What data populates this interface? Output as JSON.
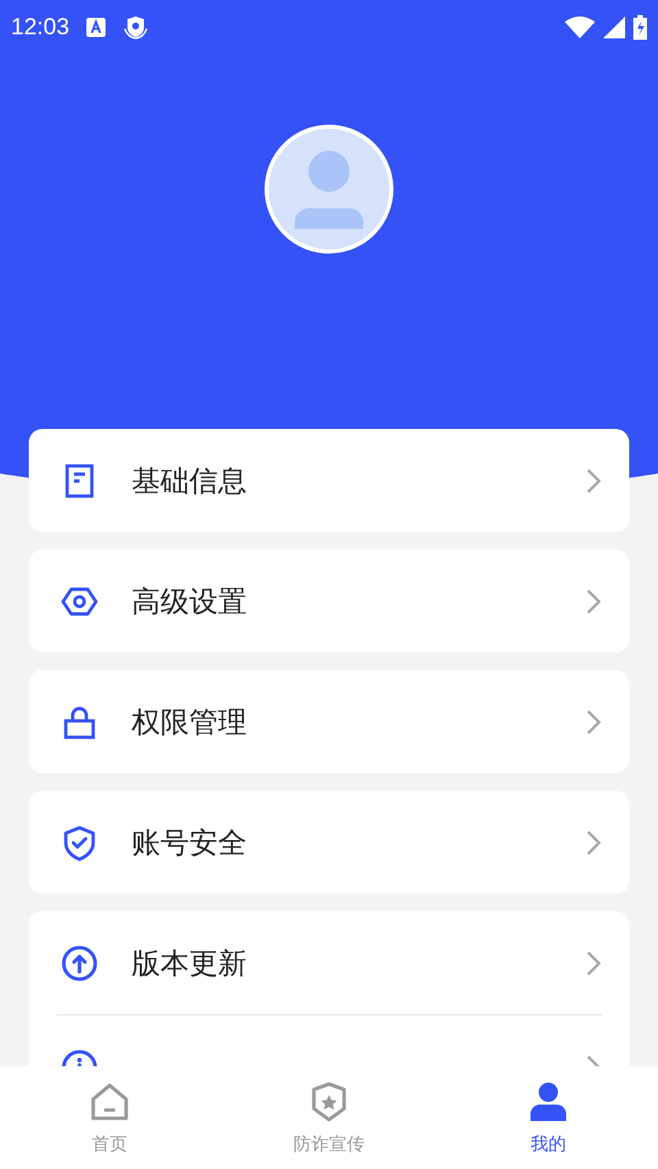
{
  "status_bar": {
    "time": "12:03"
  },
  "menu_groups": [
    {
      "items": [
        {
          "kind": "document",
          "label": "基础信息"
        }
      ]
    },
    {
      "items": [
        {
          "kind": "settings",
          "label": "高级设置"
        }
      ]
    },
    {
      "items": [
        {
          "kind": "lock",
          "label": "权限管理"
        }
      ]
    },
    {
      "items": [
        {
          "kind": "shield",
          "label": "账号安全"
        }
      ]
    },
    {
      "items": [
        {
          "kind": "upload",
          "label": "版本更新"
        },
        {
          "kind": "info"
        }
      ]
    }
  ],
  "tab_bar": [
    {
      "kind": "home",
      "label": "首页",
      "selected": false
    },
    {
      "kind": "badge",
      "label": "防诈宣传",
      "selected": false
    },
    {
      "kind": "person",
      "label": "我的",
      "selected": true
    }
  ]
}
